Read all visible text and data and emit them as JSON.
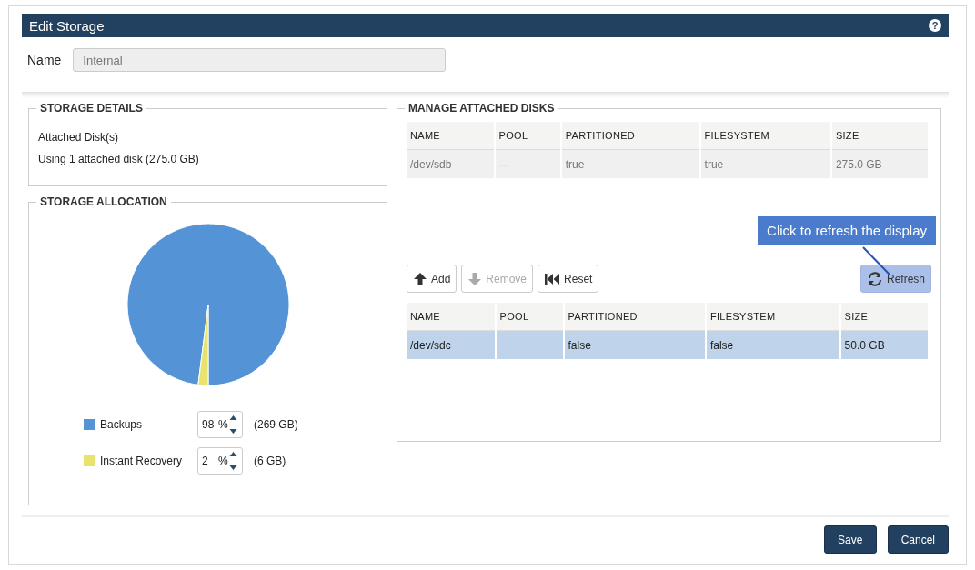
{
  "window": {
    "title": "Edit Storage",
    "help_icon": "?"
  },
  "name_field": {
    "label": "Name",
    "value": "Internal"
  },
  "storage_details": {
    "title": "STORAGE DETAILS",
    "lines": [
      "Attached Disk(s)",
      "Using 1 attached disk (275.0 GB)"
    ]
  },
  "storage_allocation": {
    "title": "STORAGE ALLOCATION",
    "items": [
      {
        "label": "Backups",
        "color": "#5593d7",
        "value": "98",
        "unit": "%",
        "size": "(269 GB)"
      },
      {
        "label": "Instant Recovery",
        "color": "#e8e36e",
        "value": "2",
        "unit": "%",
        "size": "(6 GB)"
      }
    ]
  },
  "manage_disks": {
    "title": "MANAGE ATTACHED DISKS",
    "attached_table": {
      "columns": [
        "NAME",
        "POOL",
        "PARTITIONED",
        "FILESYSTEM",
        "SIZE"
      ],
      "rows": [
        {
          "cells": [
            "/dev/sdb",
            "---",
            "true",
            "true",
            "275.0 GB"
          ],
          "selected": false
        }
      ]
    },
    "toolbar": [
      {
        "kind": "up",
        "label": "Add",
        "disabled": false,
        "highlighted": false
      },
      {
        "kind": "down",
        "label": "Remove",
        "disabled": true,
        "highlighted": false
      },
      {
        "kind": "reset",
        "label": "Reset",
        "disabled": false,
        "highlighted": false
      },
      {
        "kind": "refresh",
        "label": "Refresh",
        "disabled": false,
        "highlighted": true
      }
    ],
    "callout": "Click to refresh the display",
    "available_table": {
      "columns": [
        "NAME",
        "POOL",
        "PARTITIONED",
        "FILESYSTEM",
        "SIZE"
      ],
      "rows": [
        {
          "cells": [
            "/dev/sdc",
            "",
            "false",
            "false",
            "50.0 GB"
          ],
          "selected": true
        }
      ]
    }
  },
  "buttons": [
    "Save",
    "Cancel"
  ]
}
